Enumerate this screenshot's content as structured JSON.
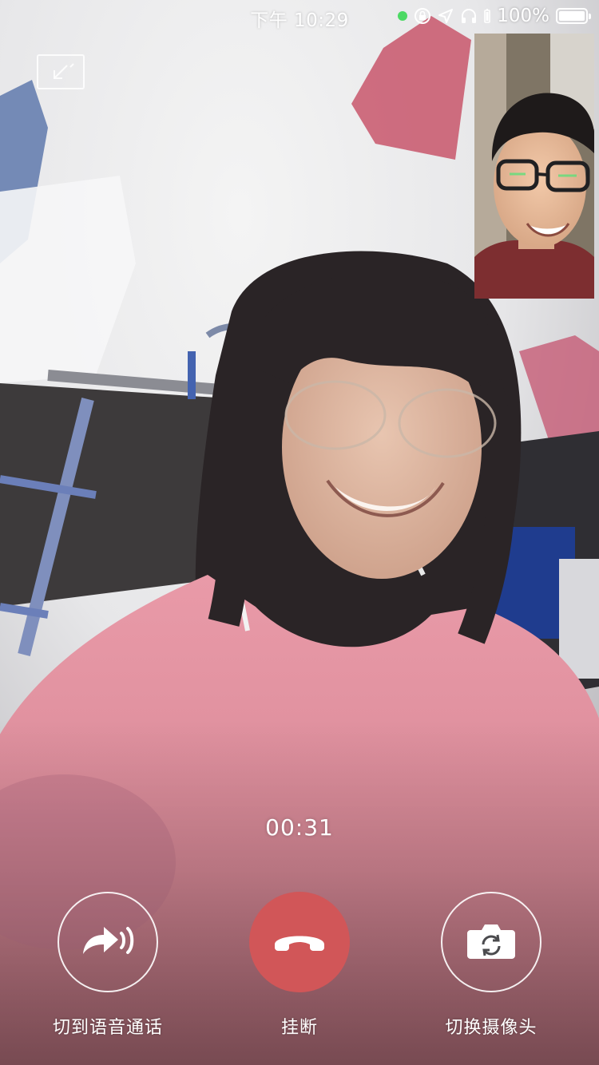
{
  "status_bar": {
    "time": "下午 10:29",
    "battery_percent": "100%",
    "icons": [
      "green-dot-indicator",
      "orientation-lock-icon",
      "location-arrow-icon",
      "headphones-icon",
      "battery-icon"
    ]
  },
  "call": {
    "duration": "00:31",
    "minimize_icon": "minimize-window-icon"
  },
  "controls": {
    "switch_voice_label": "切到语音通话",
    "hangup_label": "挂断",
    "switch_camera_label": "切换摄像头"
  },
  "colors": {
    "hangup_red": "#d15658",
    "status_green": "#4cd964",
    "text_white": "#ffffff"
  }
}
